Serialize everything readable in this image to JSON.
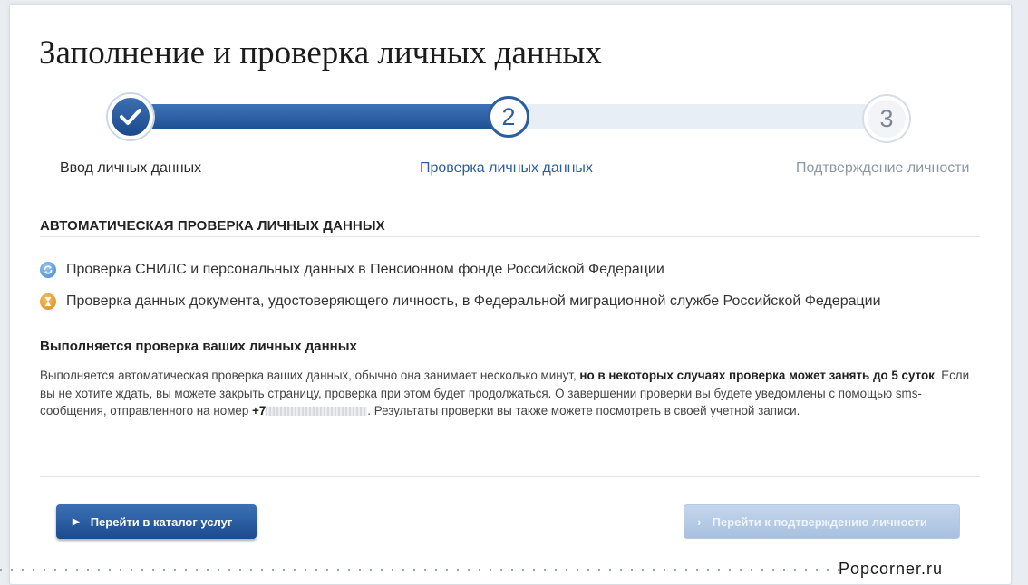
{
  "page": {
    "title": "Заполнение и проверка личных данных"
  },
  "progress": {
    "steps": [
      {
        "number": "",
        "label": "Ввод личных данных",
        "state": "completed",
        "icon": "checkmark-icon"
      },
      {
        "number": "2",
        "label": "Проверка личных данных",
        "state": "current"
      },
      {
        "number": "3",
        "label": "Подтверждение личности",
        "state": "pending"
      }
    ],
    "colors": {
      "active": "#1f4f93",
      "inactive": "#e8eef5"
    }
  },
  "auto_check": {
    "title": "АВТОМАТИЧЕСКАЯ ПРОВЕРКА ЛИЧНЫХ ДАННЫХ",
    "items": [
      {
        "icon": "sync-icon",
        "text": "Проверка СНИЛС и персональных данных в Пенсионном фонде Российской Федерации"
      },
      {
        "icon": "hourglass-icon",
        "text": "Проверка данных документа, удостоверяющего личность, в Федеральной миграционной службе Российской Федерации"
      }
    ]
  },
  "status": {
    "title": "Выполняется проверка ваших личных данных",
    "text_part1": "Выполняется автоматическая проверка ваших данных, обычно она занимает несколько минут, ",
    "text_bold1": "но в некоторых случаях проверка может занять до 5 суток",
    "text_part2": ". Если вы не хотите ждать, вы можете закрыть страницу, проверка при этом будет продолжаться. О завершении проверки вы будете уведомлены с помощью sms-сообщения, отправленного на номер ",
    "phone_prefix": "+7",
    "text_part3": ". Результаты проверки вы также можете посмотреть в своей учетной записи."
  },
  "actions": {
    "catalog_label": "Перейти в каталог услуг",
    "confirm_label": "Перейти к подтверждению личности"
  },
  "watermark": "Popcorner.ru"
}
